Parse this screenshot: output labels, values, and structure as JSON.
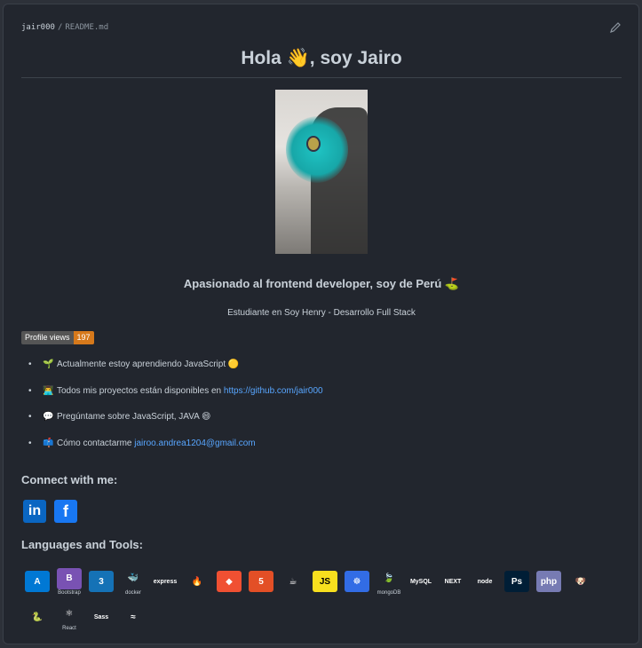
{
  "path": {
    "owner": "jair000",
    "file": "README.md"
  },
  "title": "Hola 👋, soy Jairo",
  "tagline": "Apasionado al frontend developer, soy de Perú ⛳",
  "subtagline": "Estudiante en Soy Henry - Desarrollo Full Stack",
  "badge": {
    "label": "Profile views",
    "value": "197"
  },
  "items": [
    {
      "emoji": "🌱",
      "text": "Actualmente estoy aprendiendo JavaScript 🟡",
      "link": ""
    },
    {
      "emoji": "👨‍💻",
      "text": "Todos mis proyectos están disponibles en",
      "link": "https://github.com/jair000"
    },
    {
      "emoji": "💬",
      "text": "Pregúntame sobre JavaScript, JAVA 😄",
      "link": ""
    },
    {
      "emoji": "📫",
      "text": "Cómo contactarme",
      "link": "jairoo.andrea1204@gmail.com"
    }
  ],
  "connect_heading": "Connect with me:",
  "social": [
    {
      "name": "linkedin-icon",
      "glyph": "in",
      "color": "#0a66c2"
    },
    {
      "name": "facebook-icon",
      "glyph": "f",
      "color": "#1877f2"
    }
  ],
  "tools_heading": "Languages and Tools:",
  "tools": [
    {
      "name": "azure-icon",
      "glyph": "A",
      "color": "#0078d4",
      "cap": ""
    },
    {
      "name": "bootstrap-icon",
      "glyph": "B",
      "color": "#7952b3",
      "cap": "Bootstrap"
    },
    {
      "name": "css3-icon",
      "glyph": "3",
      "color": "#1572b6",
      "cap": ""
    },
    {
      "name": "docker-icon",
      "glyph": "🐳",
      "color": "#22262e",
      "cap": "docker"
    },
    {
      "name": "express-icon",
      "glyph": "express",
      "color": "#22262e",
      "cap": ""
    },
    {
      "name": "firebase-icon",
      "glyph": "🔥",
      "color": "#22262e",
      "cap": ""
    },
    {
      "name": "git-icon",
      "glyph": "◆",
      "color": "#f05032",
      "cap": ""
    },
    {
      "name": "html5-icon",
      "glyph": "5",
      "color": "#e34f26",
      "cap": ""
    },
    {
      "name": "java-icon",
      "glyph": "☕",
      "color": "#22262e",
      "cap": ""
    },
    {
      "name": "javascript-icon",
      "glyph": "JS",
      "color": "#f7df1e",
      "cap": ""
    },
    {
      "name": "kubernetes-icon",
      "glyph": "☸",
      "color": "#326ce5",
      "cap": ""
    },
    {
      "name": "mongodb-icon",
      "glyph": "🍃",
      "color": "#22262e",
      "cap": "mongoDB"
    },
    {
      "name": "mysql-icon",
      "glyph": "MySQL",
      "color": "#22262e",
      "cap": ""
    },
    {
      "name": "nextjs-icon",
      "glyph": "NEXT",
      "color": "#22262e",
      "cap": ""
    },
    {
      "name": "nodejs-icon",
      "glyph": "node",
      "color": "#22262e",
      "cap": ""
    },
    {
      "name": "photoshop-icon",
      "glyph": "Ps",
      "color": "#001e36",
      "cap": ""
    },
    {
      "name": "php-icon",
      "glyph": "php",
      "color": "#777bb3",
      "cap": ""
    },
    {
      "name": "pug-icon",
      "glyph": "🐶",
      "color": "#22262e",
      "cap": ""
    },
    {
      "name": "python-icon",
      "glyph": "🐍",
      "color": "#22262e",
      "cap": ""
    },
    {
      "name": "react-icon",
      "glyph": "⚛",
      "color": "#22262e",
      "cap": "React"
    },
    {
      "name": "sass-icon",
      "glyph": "Sass",
      "color": "#22262e",
      "cap": ""
    },
    {
      "name": "tailwind-icon",
      "glyph": "≈",
      "color": "#22262e",
      "cap": ""
    }
  ]
}
